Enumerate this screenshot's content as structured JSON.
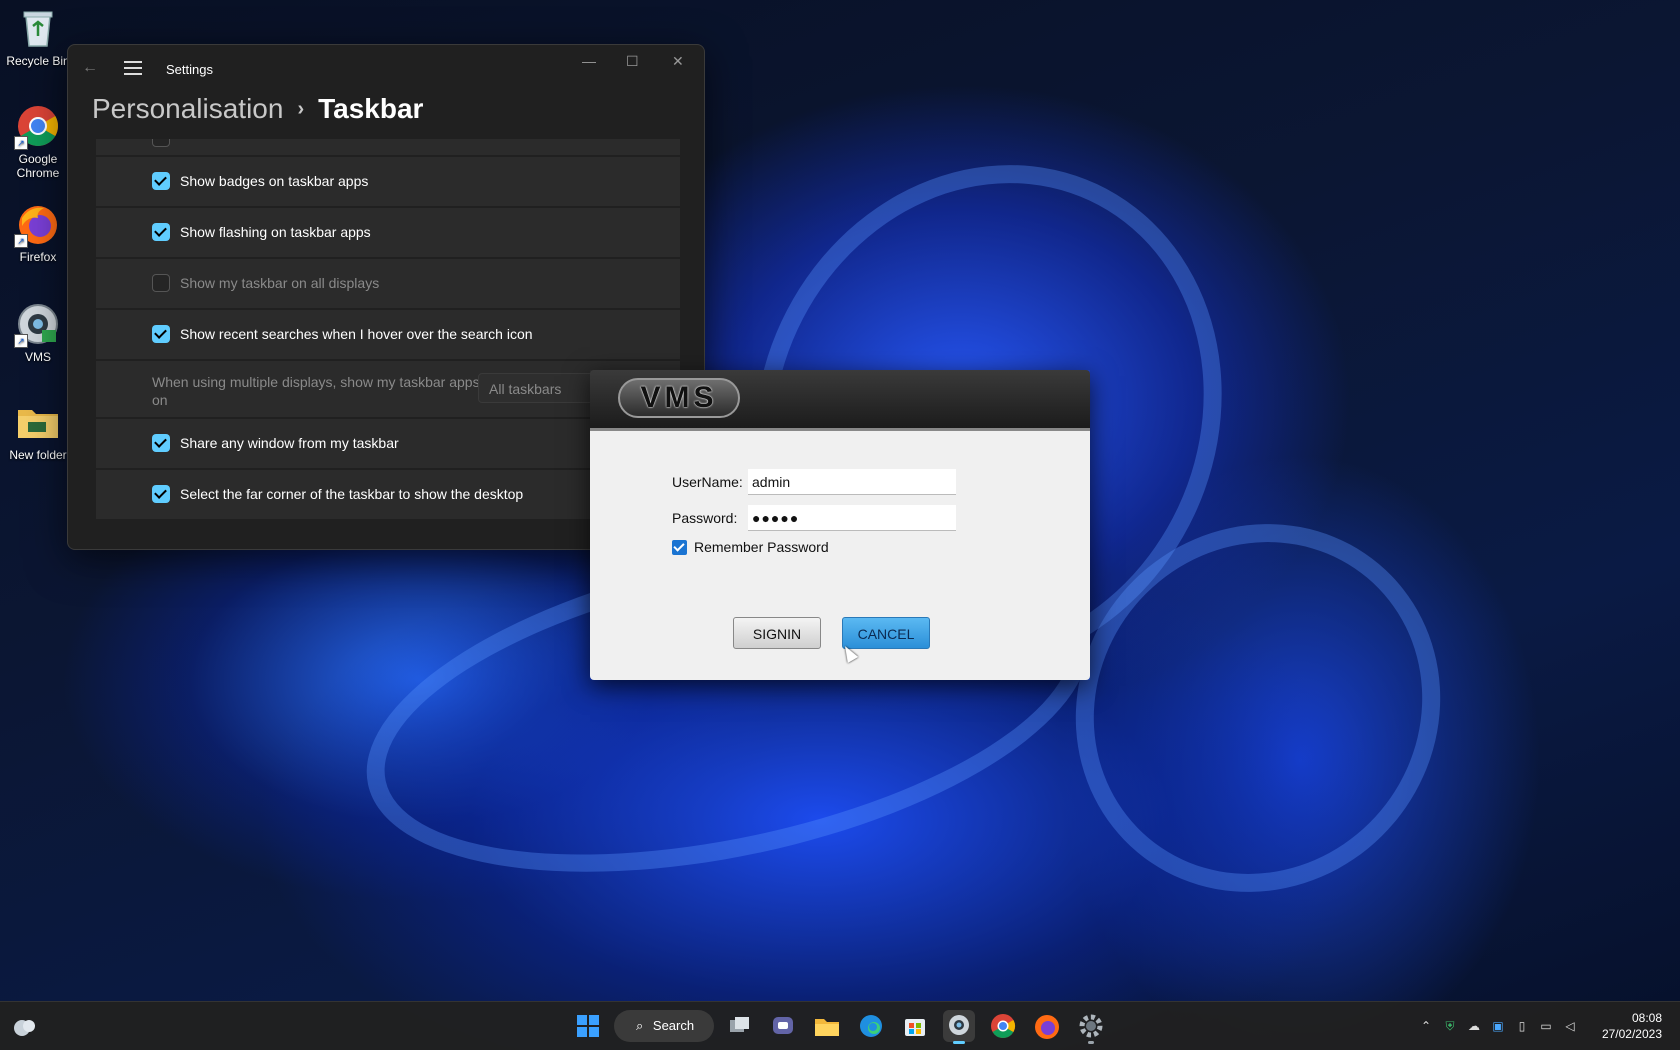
{
  "desktop": {
    "icons": [
      {
        "label": "Recycle Bin",
        "icon": "recycle-bin-icon"
      },
      {
        "label": "Google Chrome",
        "icon": "chrome-icon"
      },
      {
        "label": "Firefox",
        "icon": "firefox-icon"
      },
      {
        "label": "VMS",
        "icon": "vms-app-icon"
      },
      {
        "label": "New folder",
        "icon": "folder-icon"
      }
    ]
  },
  "settings": {
    "title": "Settings",
    "breadcrumb_parent": "Personalisation",
    "breadcrumb_separator": "›",
    "breadcrumb_current": "Taskbar",
    "window_controls": {
      "minimize": "—",
      "maximize": "☐",
      "close": "✕"
    },
    "rows": [
      {
        "label": "Show badges on taskbar apps",
        "checked": true,
        "disabled": false
      },
      {
        "label": "Show flashing on taskbar apps",
        "checked": true,
        "disabled": false
      },
      {
        "label": "Show my taskbar on all displays",
        "checked": false,
        "disabled": false
      },
      {
        "label": "Show recent searches when I hover over the search icon",
        "checked": true,
        "disabled": false
      },
      {
        "label": "When using multiple displays, show my taskbar apps on",
        "dropdown": "All taskbars",
        "disabled": true
      },
      {
        "label": "Share any window from my taskbar",
        "checked": true,
        "disabled": false
      },
      {
        "label": "Select the far corner of the taskbar to show the desktop",
        "checked": true,
        "disabled": false
      }
    ],
    "row1": "Show badges on taskbar apps",
    "row2": "Show flashing on taskbar apps",
    "row3": "Show my taskbar on all displays",
    "row4": "Show recent searches when I hover over the search icon",
    "row5": "When using multiple displays, show my taskbar apps on",
    "row5_dropdown": "All taskbars",
    "row6": "Share any window from my taskbar",
    "row7": "Select the far corner of the taskbar to show the desktop"
  },
  "vms_dialog": {
    "logo": "VMS",
    "username_label": "UserName:",
    "username_value": "admin",
    "password_label": "Password:",
    "password_value": "●●●●●",
    "remember_label": "Remember Password",
    "remember_checked": true,
    "signin_label": "SIGNIN",
    "cancel_label": "CANCEL"
  },
  "taskbar": {
    "search_label": "Search",
    "time": "08:08",
    "date": "27/02/2023",
    "apps": [
      "start-icon",
      "search",
      "task-view-icon",
      "teams-chat-icon",
      "file-explorer-icon",
      "edge-icon",
      "store-icon",
      "vms-app-icon",
      "chrome-icon",
      "firefox-icon",
      "settings-gear-icon"
    ]
  }
}
